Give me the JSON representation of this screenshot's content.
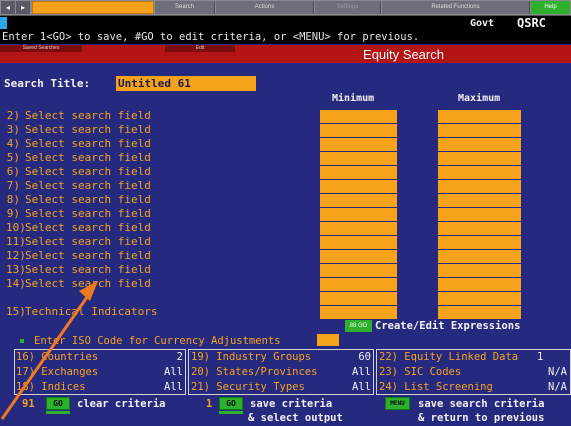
{
  "toolbar": {
    "back_glyph": "◂",
    "forward_glyph": "▸",
    "command_value": "",
    "search": "Search",
    "actions": "Actions",
    "settings": "Settings",
    "related": "Related Functions",
    "help": "Help"
  },
  "header": {
    "market": "Govt",
    "function": "QSRC"
  },
  "message": "Enter 1<GO> to save, #GO to edit criteria, or <MENU> for previous.",
  "menu": {
    "saved_searches": "Saved Searches",
    "edit": "Edit",
    "title": "Equity Search"
  },
  "search_title": {
    "label": "Search Title:",
    "value": "Untitled 61"
  },
  "columns": {
    "min": "Minimum",
    "max": "Maximum"
  },
  "fields": [
    {
      "num": "2)",
      "label": "Select search field"
    },
    {
      "num": "3)",
      "label": "Select search field"
    },
    {
      "num": "4)",
      "label": "Select search field"
    },
    {
      "num": "5)",
      "label": "Select search field"
    },
    {
      "num": "6)",
      "label": "Select search field"
    },
    {
      "num": "7)",
      "label": "Select search field"
    },
    {
      "num": "8)",
      "label": "Select search field"
    },
    {
      "num": "9)",
      "label": "Select search field"
    },
    {
      "num": "10)",
      "label": "Select search field"
    },
    {
      "num": "11)",
      "label": "Select search field"
    },
    {
      "num": "12)",
      "label": "Select search field"
    },
    {
      "num": "13)",
      "label": "Select search field"
    },
    {
      "num": "14)",
      "label": "Select search field"
    },
    {
      "num": "15)",
      "label": "Technical Indicators"
    }
  ],
  "expressions": {
    "key": "88 GO",
    "label": "Create/Edit Expressions"
  },
  "iso_line": "Enter ISO Code for Currency Adjustments",
  "panels": [
    [
      {
        "num": "16)",
        "label": "Countries",
        "value": "2"
      },
      {
        "num": "17)",
        "label": "Exchanges",
        "value": "All"
      },
      {
        "num": "18)",
        "label": "Indices",
        "value": "All"
      }
    ],
    [
      {
        "num": "19)",
        "label": "Industry Groups",
        "value": "60"
      },
      {
        "num": "20)",
        "label": "States/Provinces",
        "value": "All"
      },
      {
        "num": "21)",
        "label": "Security Types",
        "value": "All"
      }
    ],
    [
      {
        "num": "22)",
        "label": "Equity Linked Data",
        "value": "1"
      },
      {
        "num": "23)",
        "label": "SIC Codes",
        "value": "N/A"
      },
      {
        "num": "24)",
        "label": "List Screening",
        "value": "N/A"
      }
    ]
  ],
  "footer": {
    "clear_num": "91",
    "go1": "GO",
    "clear_label": "clear criteria",
    "save_num": "1",
    "go2": "GO",
    "save_line1": "save criteria",
    "save_line2": "& select output",
    "menu_key": "MENU",
    "menu_line1": "save search criteria",
    "menu_line2": "& return to previous"
  },
  "colors": {
    "background": "#262a7e",
    "accent": "#f7a21b",
    "go_green": "#2db12d",
    "menu_red": "#b31515",
    "arrow": "#f07820"
  }
}
